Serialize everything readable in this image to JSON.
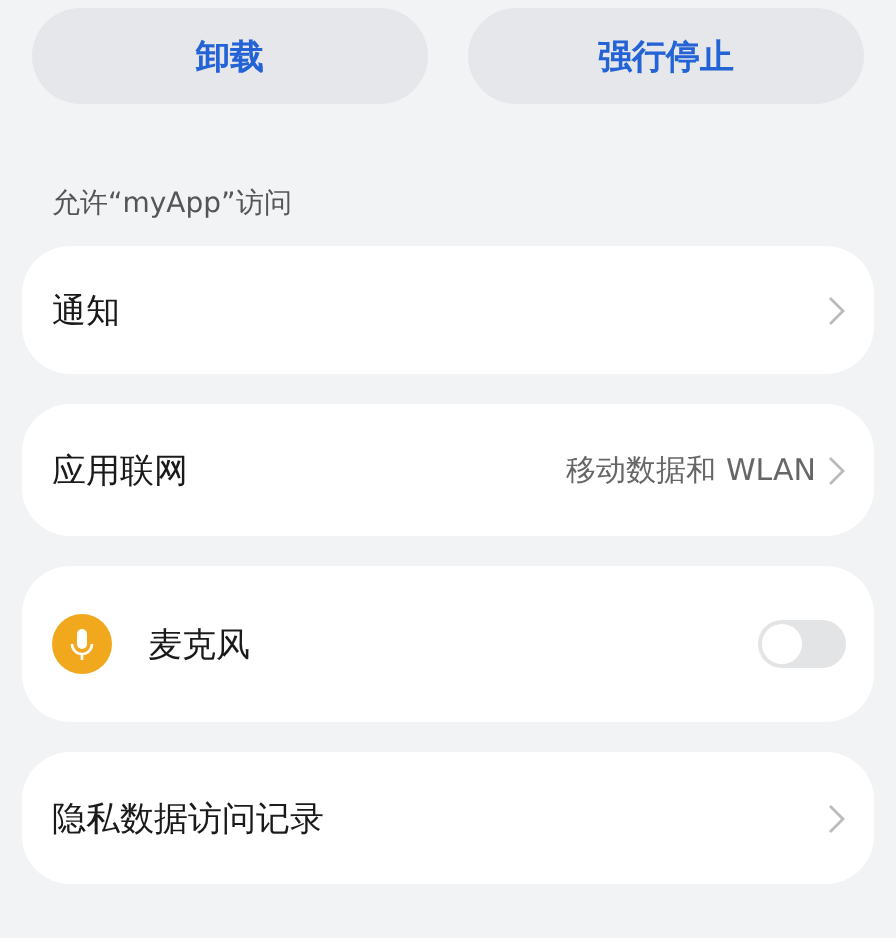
{
  "buttons": [
    {
      "label": "卸载"
    },
    {
      "label": "强行停止"
    }
  ],
  "section_title": "允许“myApp”访问",
  "items": [
    {
      "kind": "nav",
      "label": "通知"
    },
    {
      "kind": "nav",
      "label": "应用联网",
      "value": "移动数据和 WLAN"
    },
    {
      "kind": "toggle",
      "label": "麦克风",
      "on": false
    },
    {
      "kind": "nav",
      "label": "隐私数据访问记录"
    }
  ]
}
